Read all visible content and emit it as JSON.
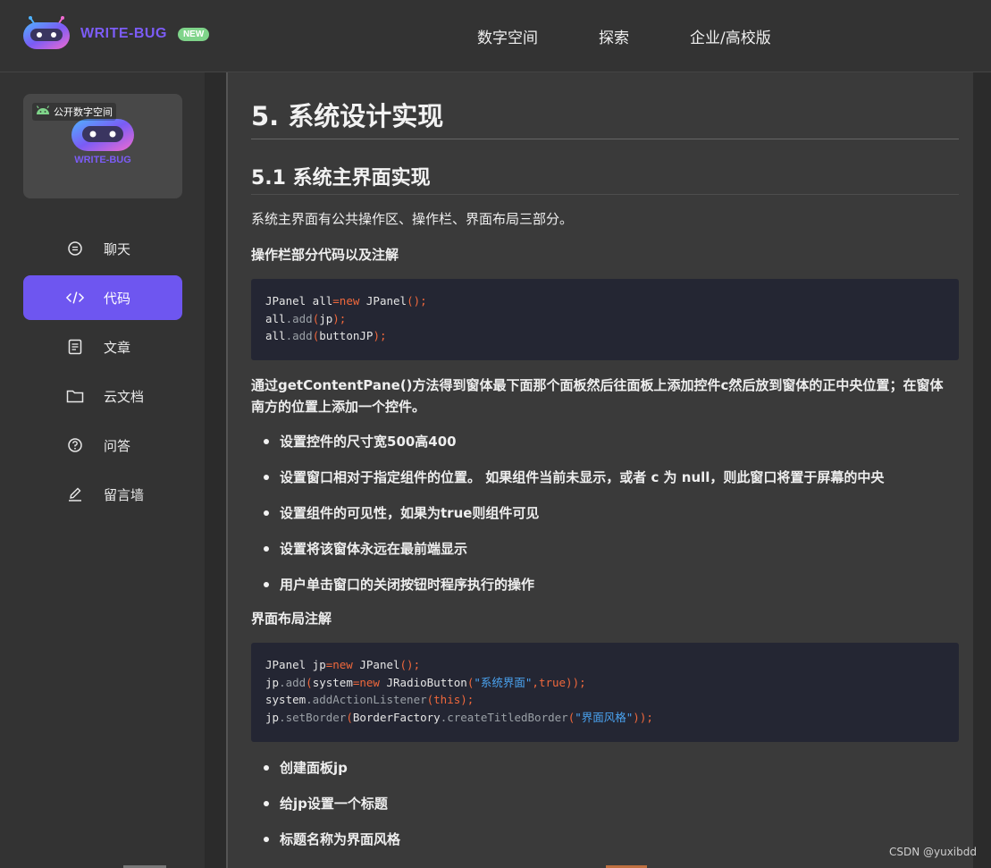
{
  "header": {
    "brand": "WRITE-BUG",
    "badge": "NEW",
    "nav": [
      "数字空间",
      "探索",
      "企业/高校版"
    ]
  },
  "sidebar": {
    "space_card": {
      "tag": "公开数字空间",
      "brand": "WRITE-BUG"
    },
    "items": [
      {
        "label": "聊天",
        "icon": "chat-icon",
        "active": false
      },
      {
        "label": "代码",
        "icon": "code-icon",
        "active": true
      },
      {
        "label": "文章",
        "icon": "article-icon",
        "active": false
      },
      {
        "label": "云文档",
        "icon": "folder-icon",
        "active": false
      },
      {
        "label": "问答",
        "icon": "question-icon",
        "active": false
      },
      {
        "label": "留言墙",
        "icon": "edit-icon",
        "active": false
      }
    ]
  },
  "article": {
    "h1": "5. 系统设计实现",
    "h2": "5.1 系统主界面实现",
    "intro": "系统主界面有公共操作区、操作栏、界面布局三部分。",
    "section1_title": "操作栏部分代码以及注解",
    "code1": [
      "JPanel all=new JPanel();",
      "all.add(jp);",
      "all.add(buttonJP);"
    ],
    "para2_line1": "通过getContentPane()方法得到窗体最下面那个面板然后往面板上添加控件c然后放到窗体的正中央位置；在窗体",
    "para2_line2": "南方的位置上添加一个控件。",
    "bullets1": [
      "设置控件的尺寸宽500高400",
      "设置窗口相对于指定组件的位置。 如果组件当前未显示，或者 c 为 null，则此窗口将置于屏幕的中央",
      "设置组件的可见性，如果为true则组件可见",
      "设置将该窗体永远在最前端显示",
      "用户单击窗口的关闭按钮时程序执行的操作"
    ],
    "section2_title": "界面布局注解",
    "code2": [
      "JPanel jp=new JPanel();",
      "jp.add(system=new JRadioButton(\"系统界面\",true));",
      "system.addActionListener(this);",
      "jp.setBorder(BorderFactory.createTitledBorder(\"界面风格\"));"
    ],
    "bullets2": [
      "创建面板jp",
      "给jp设置一个标题",
      "标题名称为界面风格"
    ]
  },
  "watermark": "CSDN @yuxibdd",
  "colors": {
    "accent": "#6e56f0",
    "brand": "#7c5cf6",
    "badge": "#7fd48a",
    "keyword": "#f0683c",
    "string": "#4aa3f0"
  }
}
